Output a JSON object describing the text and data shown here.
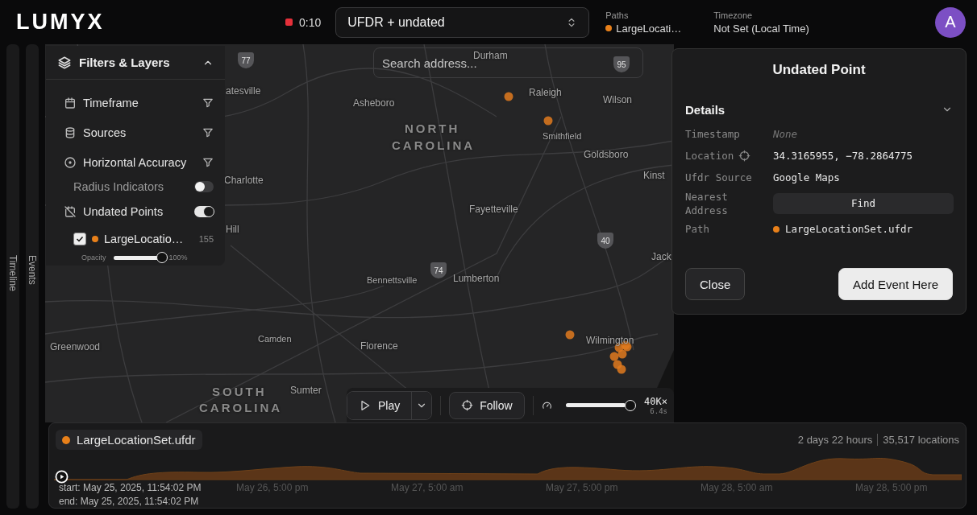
{
  "header": {
    "logo": "LUMYX",
    "recording_time": "0:10",
    "dataset_select": {
      "value": "UFDR + undated"
    },
    "paths": {
      "label": "Paths",
      "value": "LargeLocati…",
      "color": "#e8801a"
    },
    "timezone": {
      "label": "Timezone",
      "value": "Not Set (Local Time)"
    },
    "avatar": "A"
  },
  "side_rails": [
    {
      "label": "Timeline"
    },
    {
      "label": "Events"
    }
  ],
  "map": {
    "search": {
      "placeholder": "Search address..."
    },
    "labels": [
      {
        "text": "Durham",
        "kind": "city"
      },
      {
        "text": "atesville",
        "kind": "city"
      },
      {
        "text": "Asheboro",
        "kind": "city"
      },
      {
        "text": "Raleigh",
        "kind": "city"
      },
      {
        "text": "Wilson",
        "kind": "city"
      },
      {
        "text": "NORTH",
        "kind": "state"
      },
      {
        "text": "CAROLINA",
        "kind": "state"
      },
      {
        "text": "Smithfield",
        "kind": "town"
      },
      {
        "text": "Goldsboro",
        "kind": "city"
      },
      {
        "text": "Charlotte",
        "kind": "city"
      },
      {
        "text": "Kinst",
        "kind": "city"
      },
      {
        "text": "Fayetteville",
        "kind": "city"
      },
      {
        "text": "Hill",
        "kind": "city"
      },
      {
        "text": "Jack",
        "kind": "city"
      },
      {
        "text": "Bennettsville",
        "kind": "town"
      },
      {
        "text": "Lumberton",
        "kind": "city"
      },
      {
        "text": "Greenwood",
        "kind": "city"
      },
      {
        "text": "Camden",
        "kind": "town"
      },
      {
        "text": "Florence",
        "kind": "city"
      },
      {
        "text": "Wilmington",
        "kind": "city"
      },
      {
        "text": "SOUTH",
        "kind": "state"
      },
      {
        "text": "Sumter",
        "kind": "city"
      },
      {
        "text": "CAROLINA",
        "kind": "state"
      }
    ],
    "shields": [
      "77",
      "95",
      "40",
      "74"
    ]
  },
  "filters_panel": {
    "title": "Filters & Layers",
    "expanded": true,
    "items": [
      {
        "kind": "filter",
        "label": "Timeframe"
      },
      {
        "kind": "filter",
        "label": "Sources"
      },
      {
        "kind": "filter",
        "label": "Horizontal Accuracy"
      },
      {
        "kind": "subtoggle",
        "label": "Radius Indicators",
        "on": false
      },
      {
        "kind": "toggle",
        "label": "Undated Points",
        "on": true
      },
      {
        "kind": "layer",
        "label": "LargeLocatio…",
        "count": "155",
        "checked": true,
        "color": "#e8801a",
        "opacity": {
          "label": "Opacity",
          "level": 1,
          "reading": "100%"
        }
      }
    ]
  },
  "point_popup": {
    "title": "Undated Point",
    "details": {
      "title": "Details",
      "expanded": true,
      "rows": [
        {
          "kind": "empty",
          "label": "Timestamp",
          "value": "None"
        },
        {
          "kind": "location",
          "label": "Location",
          "value": "34.3165955, −78.2864775"
        },
        {
          "kind": "text",
          "label": "Ufdr Source",
          "value": "Google Maps"
        },
        {
          "kind": "button",
          "label": "Nearest Address",
          "value": "Find"
        },
        {
          "kind": "path",
          "label": "Path",
          "value": "LargeLocationSet.ufdr",
          "color": "#e8801a"
        }
      ]
    },
    "buttons": [
      {
        "label": "Close",
        "kind": "secondary"
      },
      {
        "label": "Add Event Here",
        "kind": "primary"
      }
    ]
  },
  "playback": {
    "play": "Play",
    "follow": "Follow",
    "speed": {
      "level": 0.93,
      "reading": "40K×",
      "duration": "6.4s"
    }
  },
  "timeline": {
    "track": {
      "name": "LargeLocationSet.ufdr",
      "color": "#e8801a"
    },
    "duration": "2 days 22 hours",
    "locations": "35,517 locations",
    "axis_labels": [
      "May 26, 5:00 pm",
      "May 27, 5:00 am",
      "May 27, 5:00 pm",
      "May 28, 5:00 am",
      "May 28, 5:00 pm"
    ],
    "start": "start: May 25, 2025, 11:54:02 PM",
    "end": "end: May 25, 2025, 11:54:02 PM"
  }
}
